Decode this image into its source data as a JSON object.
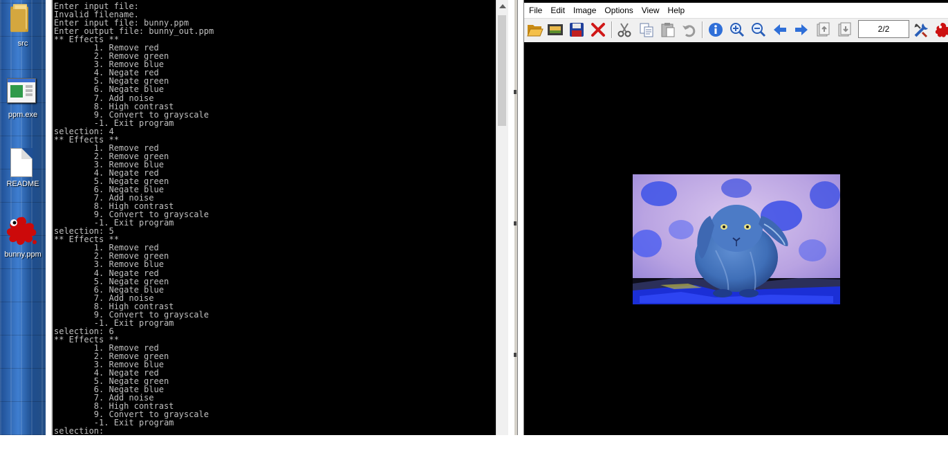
{
  "desktop": {
    "icons": [
      {
        "label": "src",
        "icon": "folder-icon"
      },
      {
        "label": "ppm.exe",
        "icon": "application-icon"
      },
      {
        "label": "README",
        "icon": "text-file-icon"
      },
      {
        "label": "bunny.ppm",
        "icon": "paint-splat-icon"
      }
    ]
  },
  "console": {
    "text": "Enter input file:\nInvalid filename.\nEnter input file: bunny.ppm\nEnter output file: bunny_out.ppm\n** Effects **\n        1. Remove red\n        2. Remove green\n        3. Remove blue\n        4. Negate red\n        5. Negate green\n        6. Negate blue\n        7. Add noise\n        8. High contrast\n        9. Convert to grayscale\n        -1. Exit program\nselection: 4\n** Effects **\n        1. Remove red\n        2. Remove green\n        3. Remove blue\n        4. Negate red\n        5. Negate green\n        6. Negate blue\n        7. Add noise\n        8. High contrast\n        9. Convert to grayscale\n        -1. Exit program\nselection: 5\n** Effects **\n        1. Remove red\n        2. Remove green\n        3. Remove blue\n        4. Negate red\n        5. Negate green\n        6. Negate blue\n        7. Add noise\n        8. High contrast\n        9. Convert to grayscale\n        -1. Exit program\nselection: 6\n** Effects **\n        1. Remove red\n        2. Remove green\n        3. Remove blue\n        4. Negate red\n        5. Negate green\n        6. Negate blue\n        7. Add noise\n        8. High contrast\n        9. Convert to grayscale\n        -1. Exit program\nselection:",
    "text_color": "#c0c0c0",
    "background": "#000000"
  },
  "viewer": {
    "menu": [
      "File",
      "Edit",
      "Image",
      "Options",
      "View",
      "Help"
    ],
    "page_indicator": "2/2",
    "toolbar_icons": [
      "open-folder-icon",
      "slideshow-icon",
      "save-icon",
      "delete-icon",
      "cut-icon",
      "copy-icon",
      "paste-icon",
      "undo-icon",
      "info-icon",
      "zoom-in-icon",
      "zoom-out-icon",
      "previous-arrow-icon",
      "next-arrow-icon",
      "first-page-icon",
      "last-page-icon",
      "settings-icon",
      "exit-icon"
    ],
    "image_subject": "color-negated photo of a lop-eared bunny"
  }
}
